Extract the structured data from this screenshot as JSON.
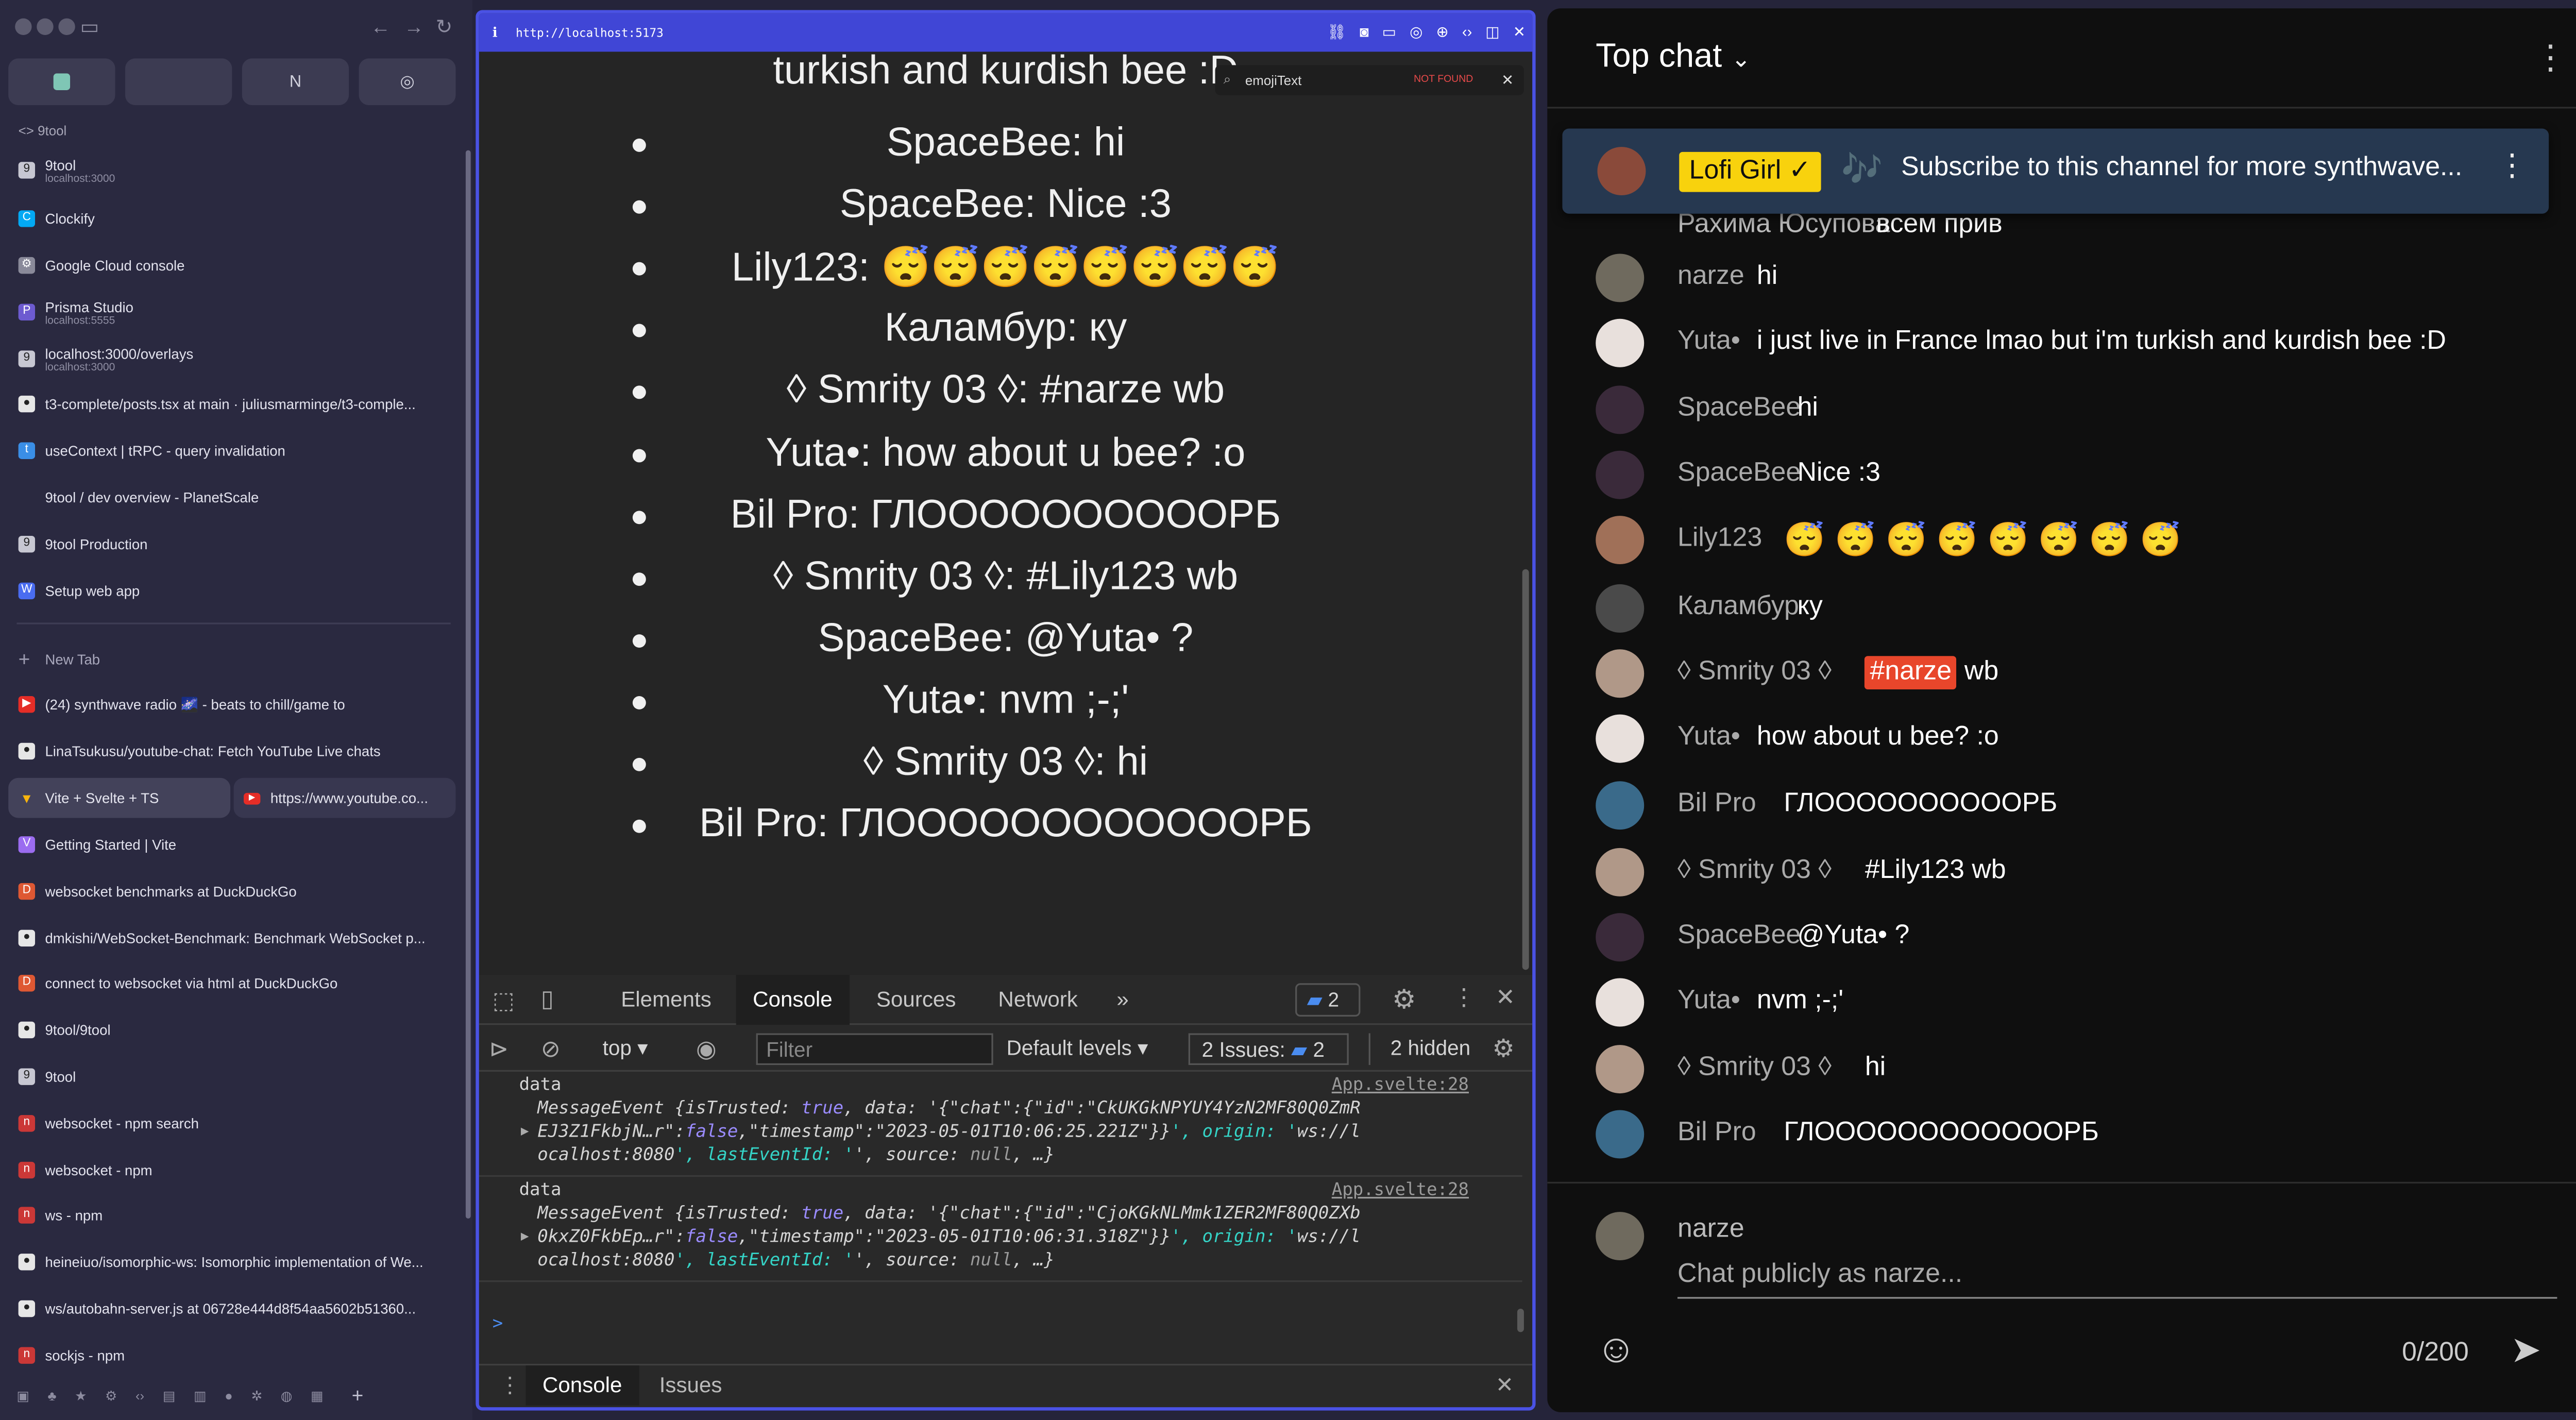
{
  "sidebar": {
    "dev_label": "<> 9tool",
    "pinned_tabs": [
      "",
      "",
      "",
      ""
    ],
    "tabs_top": [
      {
        "title": "9tool",
        "sub": "localhost:3000",
        "icon": "9",
        "color": "#c7c7d2"
      },
      {
        "title": "Clockify",
        "sub": "",
        "icon": "C",
        "color": "#03a9f4"
      },
      {
        "title": "Google Cloud console",
        "sub": "",
        "icon": "⚙",
        "color": "#8a8a9a"
      },
      {
        "title": "Prisma Studio",
        "sub": "localhost:5555",
        "icon": "P",
        "color": "#6d5bd0"
      },
      {
        "title": "localhost:3000/overlays",
        "sub": "localhost:3000",
        "icon": "9",
        "color": "#c7c7d2"
      },
      {
        "title": "t3-complete/posts.tsx at main · juliusmarminge/t3-comple...",
        "sub": "",
        "icon": "●",
        "color": "#e6e6e6"
      },
      {
        "title": "useContext | tRPC - query invalidation",
        "sub": "",
        "icon": "t",
        "color": "#3a8ee6"
      },
      {
        "title": "9tool / dev overview - PlanetScale",
        "sub": "",
        "icon": "",
        "color": "#2a2940"
      },
      {
        "title": "9tool Production",
        "sub": "",
        "icon": "9",
        "color": "#c7c7d2"
      },
      {
        "title": "Setup web app",
        "sub": "",
        "icon": "W",
        "color": "#4a6cf0"
      }
    ],
    "new_tab": "New Tab",
    "tabs_bottom": [
      {
        "title": "(24) synthwave radio 🌌 - beats to chill/game to",
        "icon": "▶",
        "color": "#e52d27"
      },
      {
        "title": "LinaTsukusu/youtube-chat: Fetch YouTube Live chats",
        "icon": "●",
        "color": "#e6e6e6"
      }
    ],
    "split_left": "Vite + Svelte + TS",
    "split_right": "https://www.youtube.co...",
    "tabs_rest": [
      {
        "title": "Getting Started | Vite",
        "icon": "V",
        "color": "#9b6cf0"
      },
      {
        "title": "websocket benchmarks at DuckDuckGo",
        "icon": "D",
        "color": "#de5833"
      },
      {
        "title": "dmkishi/WebSocket-Benchmark: Benchmark WebSocket p...",
        "icon": "●",
        "color": "#e6e6e6"
      },
      {
        "title": "connect to websocket via html at DuckDuckGo",
        "icon": "D",
        "color": "#de5833"
      },
      {
        "title": "9tool/9tool",
        "icon": "●",
        "color": "#e6e6e6"
      },
      {
        "title": "9tool",
        "icon": "9",
        "color": "#c7c7d2"
      },
      {
        "title": "websocket - npm search",
        "icon": "n",
        "color": "#cb3837"
      },
      {
        "title": "websocket - npm",
        "icon": "n",
        "color": "#cb3837"
      },
      {
        "title": "ws - npm",
        "icon": "n",
        "color": "#cb3837"
      },
      {
        "title": "heineiuo/isomorphic-ws: Isomorphic implementation of We...",
        "icon": "●",
        "color": "#e6e6e6"
      },
      {
        "title": "ws/autobahn-server.js at 06728e444d8f54aa5602b51360...",
        "icon": "●",
        "color": "#e6e6e6"
      },
      {
        "title": "sockjs - npm",
        "icon": "n",
        "color": "#cb3837"
      }
    ]
  },
  "browser": {
    "url": "http://localhost:5173",
    "find_text": "emojiText",
    "find_status": "NOT FOUND",
    "partial_top": "turkish and kurdish bee :D",
    "messages": [
      "SpaceBee: hi",
      "SpaceBee: Nice :3",
      "Lily123: 😴😴😴😴😴😴😴😴",
      "Каламбур: ку",
      "◊ Smrity 03 ◊: #narze wb",
      "Yuta•: how about u bee? :o",
      "Bil Pro: ГЛООООООООООРБ",
      "◊ Smrity 03 ◊: #Lily123 wb",
      "SpaceBee: @Yuta• ?",
      "Yuta•: nvm ;-;'",
      "◊ Smrity 03 ◊: hi",
      "Bil Pro: ГЛООООООООООООРБ"
    ]
  },
  "devtools": {
    "tabs": [
      "Elements",
      "Console",
      "Sources",
      "Network"
    ],
    "active_tab": "Console",
    "more": "»",
    "message_badge": "2",
    "context": "top",
    "filter_placeholder": "Filter",
    "levels": "Default levels",
    "issues": "2 Issues:",
    "issues_count": "2",
    "hidden": "2 hidden",
    "logs": [
      {
        "label": "data",
        "source": "App.svelte:28",
        "l1": "MessageEvent {isTrusted: true, data: '{\"chat\":{\"id\":\"CkUKGkNPYUY4YzN2MF80Q0ZmR",
        "l2": "EJ3Z1FkbjN…r\":false,\"timestamp\":\"2023-05-01T10:06:25.221Z\"}}', origin: 'ws://l",
        "l3": "ocalhost:8080', lastEventId: '', source: null, …}"
      },
      {
        "label": "data",
        "source": "App.svelte:28",
        "l1": "MessageEvent {isTrusted: true, data: '{\"chat\":{\"id\":\"CjoKGkNLMmk1ZER2MF80Q0ZXb",
        "l2": "0kxZ0FkbEp…r\":false,\"timestamp\":\"2023-05-01T10:06:31.318Z\"}}', origin: 'ws://l",
        "l3": "ocalhost:8080', lastEventId: '', source: null, …}"
      }
    ],
    "prompt": ">",
    "drawer_tabs": [
      "Console",
      "Issues"
    ]
  },
  "chat": {
    "title": "Top chat",
    "pinned": {
      "author": "Lofi Girl",
      "badge": "✓",
      "music": "🎶",
      "text": "Subscribe to this channel for more synthwave..."
    },
    "partial": {
      "author": "Рахима Юсупова",
      "text": "всем прив"
    },
    "messages": [
      {
        "author": "narze",
        "text": "hi",
        "mention": "",
        "suffix": "",
        "avatar": "#6f6a5e"
      },
      {
        "author": "Yuta•",
        "text": "i just live in France lmao but i'm turkish and kurdish bee :D",
        "mention": "",
        "suffix": "",
        "avatar": "#e8e0dc"
      },
      {
        "author": "SpaceBee",
        "text": "hi",
        "mention": "",
        "suffix": "",
        "avatar": "#3a2a3a"
      },
      {
        "author": "SpaceBee",
        "text": "Nice :3",
        "mention": "",
        "suffix": "",
        "avatar": "#3a2a3a"
      },
      {
        "author": "Lily123",
        "text": "😴 😴 😴 😴 😴 😴 😴 😴",
        "mention": "",
        "suffix": "",
        "avatar": "#a07058"
      },
      {
        "author": "Каламбур",
        "text": "ку",
        "mention": "",
        "suffix": "",
        "avatar": "#4a4a4a"
      },
      {
        "author": "◊ Smrity 03 ◊",
        "text": "",
        "mention": "#narze",
        "suffix": "wb",
        "avatar": "#b09888"
      },
      {
        "author": "Yuta•",
        "text": "how about u bee? :o",
        "mention": "",
        "suffix": "",
        "avatar": "#e8e0dc"
      },
      {
        "author": "Bil Pro",
        "text": "ГЛООООООООООРБ",
        "mention": "",
        "suffix": "",
        "avatar": "#3a6a8a"
      },
      {
        "author": "◊ Smrity 03 ◊",
        "text": "#Lily123 wb",
        "mention": "",
        "suffix": "",
        "avatar": "#b09888"
      },
      {
        "author": "SpaceBee",
        "text": "@Yuta• ?",
        "mention": "",
        "suffix": "",
        "avatar": "#3a2a3a"
      },
      {
        "author": "Yuta•",
        "text": "nvm ;-;'",
        "mention": "",
        "suffix": "",
        "avatar": "#e8e0dc"
      },
      {
        "author": "◊ Smrity 03 ◊",
        "text": "hi",
        "mention": "",
        "suffix": "",
        "avatar": "#b09888"
      },
      {
        "author": "Bil Pro",
        "text": "ГЛООООООООООООРБ",
        "mention": "",
        "suffix": "",
        "avatar": "#3a6a8a"
      }
    ],
    "composer": {
      "author": "narze",
      "placeholder": "Chat publicly as narze...",
      "counter": "0/200"
    }
  },
  "colors": {
    "accent": "#4046d6",
    "mention": "#e8462b",
    "pinned_bg": "#263850",
    "badge_yellow": "#f8d20d"
  }
}
